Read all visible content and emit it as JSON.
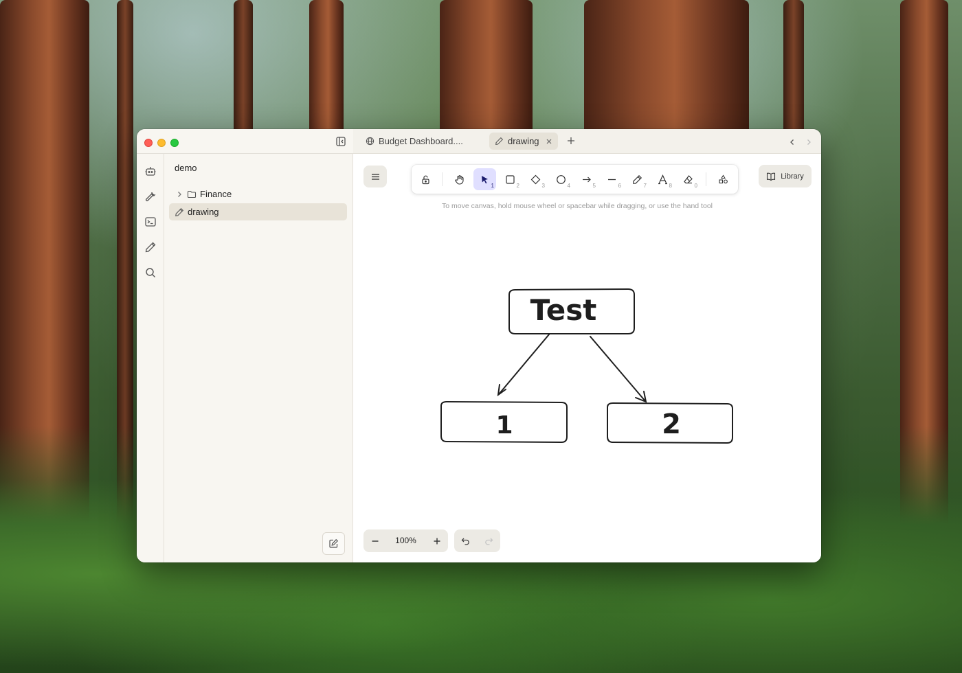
{
  "window": {
    "controls": [
      "close",
      "minimize",
      "zoom"
    ]
  },
  "sidebar": {
    "vault_name": "demo",
    "rail_icons": [
      "bot-icon",
      "wrench-icon",
      "terminal-icon",
      "pencil-icon",
      "search-icon"
    ],
    "items": [
      {
        "type": "folder",
        "label": "Finance",
        "icon": "folder-icon"
      },
      {
        "type": "file",
        "label": "drawing",
        "icon": "pencil-icon",
        "selected": true
      }
    ]
  },
  "tabs": [
    {
      "label": "Budget Dashboard....",
      "icon": "globe-icon",
      "active": false
    },
    {
      "label": "drawing",
      "icon": "pencil-icon",
      "active": true
    }
  ],
  "toolbar": {
    "tools": [
      {
        "name": "lock",
        "key": ""
      },
      {
        "name": "hand",
        "key": ""
      },
      {
        "name": "selection",
        "key": "1",
        "active": true
      },
      {
        "name": "rectangle",
        "key": "2"
      },
      {
        "name": "diamond",
        "key": "3"
      },
      {
        "name": "ellipse",
        "key": "4"
      },
      {
        "name": "arrow",
        "key": "5"
      },
      {
        "name": "line",
        "key": "6"
      },
      {
        "name": "draw",
        "key": "7"
      },
      {
        "name": "text",
        "key": "8"
      },
      {
        "name": "eraser",
        "key": "0"
      },
      {
        "name": "extra-tools",
        "key": ""
      }
    ],
    "library_label": "Library"
  },
  "canvas": {
    "hint": "To move canvas, hold mouse wheel or spacebar while dragging, or use the hand tool",
    "shapes": [
      {
        "label": "Test"
      },
      {
        "label": "1"
      },
      {
        "label": "2"
      }
    ]
  },
  "footer": {
    "zoom_level": "100%"
  },
  "colors": {
    "accent": "#e0dfff",
    "accent_text": "#1b1b6d",
    "selected_item": "#e8e3d8"
  }
}
